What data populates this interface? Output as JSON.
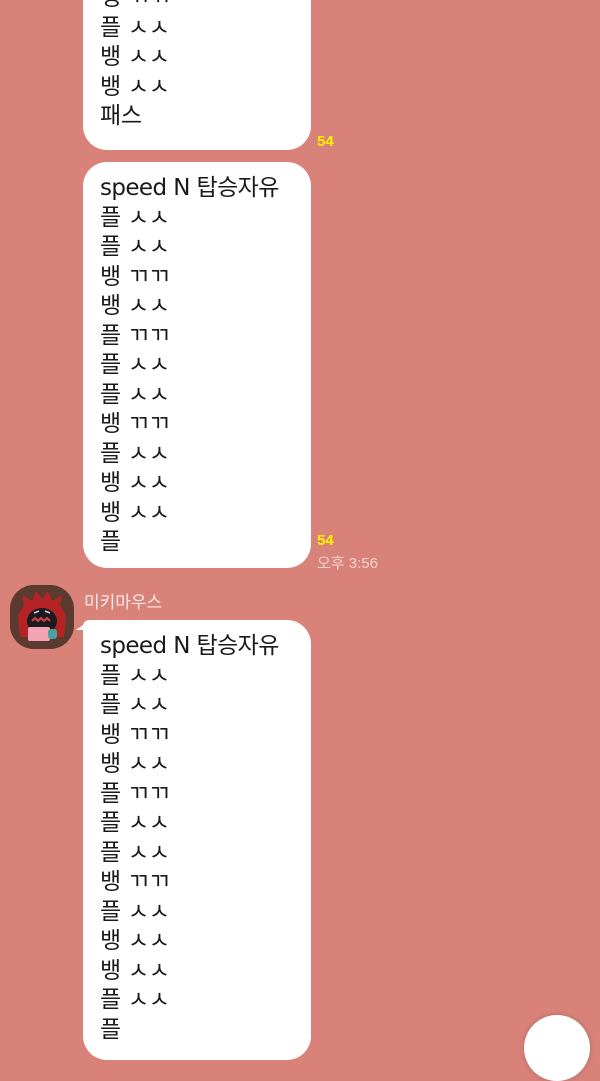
{
  "messages": [
    {
      "lines": [
        "뱅 ㄲㄲ",
        "플 ㅅㅅ",
        "뱅 ㅅㅅ",
        "뱅 ㅅㅅ",
        "패스"
      ],
      "unread": "54"
    },
    {
      "lines": [
        "speed N 탑승자유",
        "플 ㅅㅅ",
        "플 ㅅㅅ",
        "뱅 ㄲㄲ",
        "뱅 ㅅㅅ",
        "플 ㄲㄲ",
        "플 ㅅㅅ",
        "플 ㅅㅅ",
        "뱅 ㄲㄲ",
        "플 ㅅㅅ",
        "뱅 ㅅㅅ",
        "뱅 ㅅㅅ",
        "플"
      ],
      "unread": "54",
      "time": "오후 3:56"
    },
    {
      "sender": "미키마우스",
      "lines": [
        "speed N 탑승자유",
        "플 ㅅㅅ",
        "플 ㅅㅅ",
        "뱅 ㄲㄲ",
        "뱅 ㅅㅅ",
        "플 ㄲㄲ",
        "플 ㅅㅅ",
        "플 ㅅㅅ",
        "뱅 ㄲㄲ",
        "플 ㅅㅅ",
        "뱅 ㅅㅅ",
        "뱅 ㅅㅅ",
        "플 ㅅㅅ",
        "플"
      ]
    }
  ],
  "colors": {
    "background": "#d9827a",
    "bubble": "#ffffff",
    "unread": "#fff200"
  },
  "icons": {
    "avatar": "profile-avatar-icon",
    "fab": "scroll-button-icon"
  }
}
